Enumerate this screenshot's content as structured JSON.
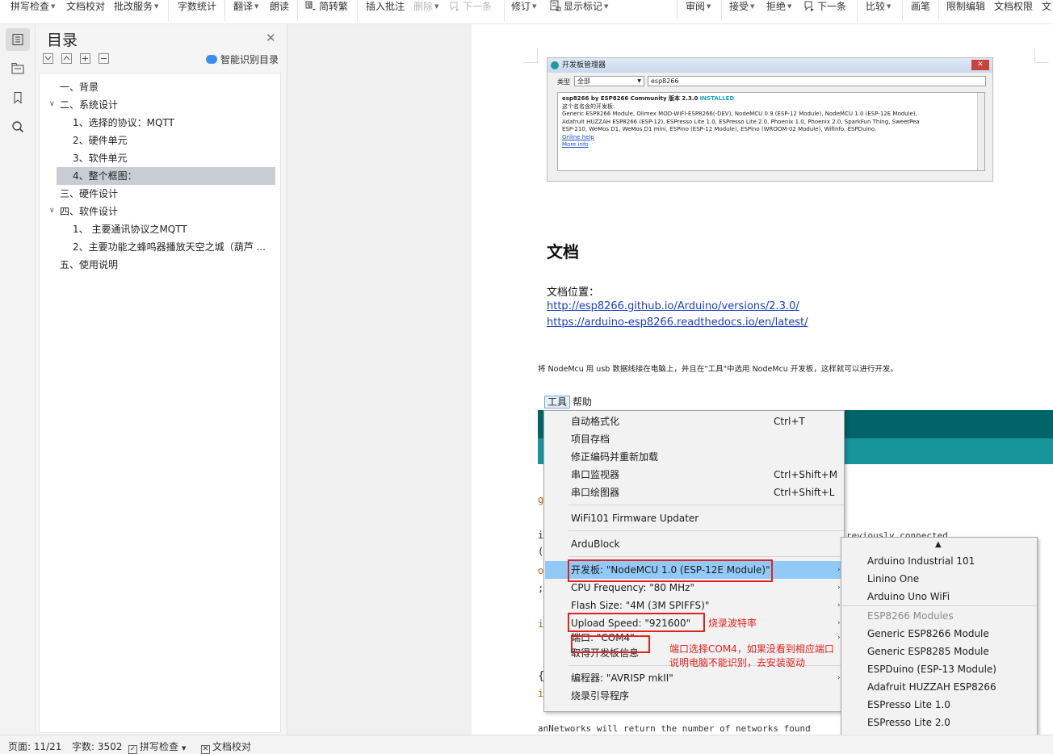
{
  "toolbar": {
    "items": [
      {
        "label": "拼写检查",
        "caret": true
      },
      {
        "label": "文档校对",
        "caret": false
      },
      {
        "label": "批改服务",
        "caret": true
      },
      {
        "label": "字数统计",
        "caret": false
      },
      {
        "label": "翻译",
        "caret": true
      },
      {
        "label": "朗读",
        "caret": false
      },
      {
        "label": "简转繁",
        "caret": false
      },
      {
        "label": "插入批注",
        "caret": false
      },
      {
        "label": "删除",
        "caret": true
      },
      {
        "label": "下一条",
        "caret": false
      },
      {
        "label": "修订",
        "caret": true
      },
      {
        "label": "显示标记",
        "caret": true
      },
      {
        "label": "审阅",
        "caret": true
      },
      {
        "label": "接受",
        "caret": true
      },
      {
        "label": "拒绝",
        "caret": true
      },
      {
        "label": "下一条",
        "caret": false
      },
      {
        "label": "比较",
        "caret": true
      },
      {
        "label": "画笔",
        "caret": false
      },
      {
        "label": "限制编辑",
        "caret": false
      },
      {
        "label": "文档权限",
        "caret": false
      },
      {
        "label": "文",
        "caret": false
      }
    ]
  },
  "rail": {
    "icons": [
      "toc-icon",
      "chapter-nav-icon",
      "bookmark-icon",
      "search-icon"
    ]
  },
  "toc": {
    "title": "目录",
    "smart_label": "智能识别目录",
    "items": [
      {
        "text": "一、背景",
        "level": 1,
        "arrow": false
      },
      {
        "text": "二、系统设计",
        "level": 1,
        "arrow": true
      },
      {
        "text": "1、选择的协议：MQTT",
        "level": 2,
        "arrow": false
      },
      {
        "text": "2、硬件单元",
        "level": 2,
        "arrow": false
      },
      {
        "text": "3、软件单元",
        "level": 2,
        "arrow": false
      },
      {
        "text": "4、整个框图：",
        "level": 2,
        "arrow": false,
        "selected": true
      },
      {
        "text": "三、硬件设计",
        "level": 1,
        "arrow": false
      },
      {
        "text": "四、软件设计",
        "level": 1,
        "arrow": true
      },
      {
        "text": "1、 主要通讯协议之MQTT",
        "level": 2,
        "arrow": false
      },
      {
        "text": "2、主要功能之蜂鸣器播放天空之城（葫芦 ...",
        "level": 2,
        "arrow": false
      },
      {
        "text": "五、使用说明",
        "level": 1,
        "arrow": false
      }
    ]
  },
  "screenshot1": {
    "window_title": "开发板管理器",
    "type_label": "类型",
    "type_value": "全部",
    "search_value": "esp8266",
    "heading_pre": "esp8266 by ESP8266 Community 版本 2.3.0",
    "installed": "INSTALLED",
    "desc": "这个名名含的开发板:",
    "boards_line1": "Generic ESP8266 Module, Olimex MOD-WIFI-ESP8266(-DEV), NodeMCU 0.9 (ESP-12 Module), NodeMCU 1.0 (ESP-12E Module),",
    "boards_line2": "Adafruit HUZZAH ESP8266 (ESP-12), ESPresso Lite 1.0, ESPresso Lite 2.0, Phoenix 1.0, Phoenix 2.0, SparkFun Thing, SweetPea",
    "boards_line3": "ESP-210, WeMos D1, WeMos D1 mini, ESPino (ESP-12 Module), ESPino (WROOM-02 Module), WifInfo, ESPDuino.",
    "online_help": "Online help",
    "more_info": "More info"
  },
  "doc": {
    "heading": "文档",
    "location_label": "文档位置：",
    "link1": "http://esp8266.github.io/Arduino/versions/2.3.0/",
    "link2": "https://arduino-esp8266.readthedocs.io/en/latest/",
    "instruction": "将 NodeMcu 用 usb 数据线接在电脑上，并且在\"工具\"中选用 NodeMcu 开发板，这样就可以进行开发。"
  },
  "arduino": {
    "menubar": [
      "工具",
      "帮助"
    ],
    "menu_items": [
      {
        "label": "自动格式化",
        "shortcut": "Ctrl+T"
      },
      {
        "label": "项目存档",
        "shortcut": ""
      },
      {
        "label": "修正编码并重新加载",
        "shortcut": ""
      },
      {
        "label": "串口监视器",
        "shortcut": "Ctrl+Shift+M"
      },
      {
        "label": "串口绘图器",
        "shortcut": "Ctrl+Shift+L"
      },
      {
        "label": "WiFi101 Firmware Updater",
        "shortcut": ""
      },
      {
        "label": "ArduBlock",
        "shortcut": ""
      },
      {
        "label": "开发板: \"NodeMCU 1.0 (ESP-12E Module)\"",
        "shortcut": ""
      },
      {
        "label": "CPU Frequency: \"80 MHz\"",
        "shortcut": ""
      },
      {
        "label": "Flash Size: \"4M (3M SPIFFS)\"",
        "shortcut": ""
      },
      {
        "label": "Upload Speed: \"921600\"",
        "shortcut": ""
      },
      {
        "label": "端口: \"COM4\"",
        "shortcut": ""
      },
      {
        "label": "取得开发板信息",
        "shortcut": ""
      },
      {
        "label": "编程器: \"AVRISP mkII\"",
        "shortcut": ""
      },
      {
        "label": "烧录引导程序",
        "shortcut": ""
      }
    ],
    "annotation_speed": "烧录波特率",
    "annotation_port_line1": "端口选择COM4，如果没看到相应端口",
    "annotation_port_line2": "说明电脑不能识别，去安装驱动",
    "submenu_items": [
      {
        "label": "Arduino Industrial 101",
        "gray": false
      },
      {
        "label": "Linino One",
        "gray": false
      },
      {
        "label": "Arduino Uno WiFi",
        "gray": false
      },
      {
        "label": "ESP8266 Modules",
        "gray": true
      },
      {
        "label": "Generic ESP8266 Module",
        "gray": false
      },
      {
        "label": "Generic ESP8285 Module",
        "gray": false
      },
      {
        "label": "ESPDuino (ESP-13 Module)",
        "gray": false
      },
      {
        "label": "Adafruit HUZZAH ESP8266",
        "gray": false
      },
      {
        "label": "ESPresso Lite 1.0",
        "gray": false
      },
      {
        "label": "ESPresso Lite 2.0",
        "gray": false
      }
    ],
    "code_fragment_1": "reviously connected",
    "code_bottom": "anNetworks will return the number of networks found"
  },
  "status": {
    "page": "页面: 11/21",
    "words": "字数: 3502",
    "spell": "拼写检查",
    "proof": "文档校对"
  },
  "colors": {
    "teal_dark": "#006468",
    "teal_light": "#18959b",
    "highlight": "#91c9f7",
    "annotation_red": "#e0231f",
    "link_blue": "#1a3fc9"
  }
}
